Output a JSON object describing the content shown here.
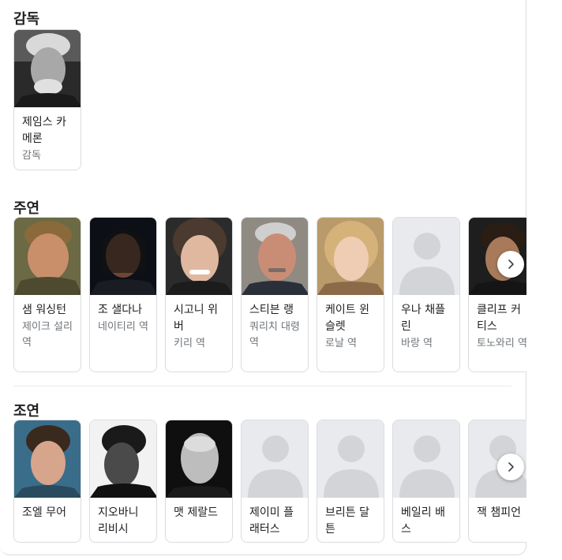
{
  "sections": {
    "director": {
      "title": "감독",
      "cards": [
        {
          "name": "제임스 카메론",
          "role": "감독"
        }
      ]
    },
    "lead": {
      "title": "주연",
      "cards": [
        {
          "name": "샘 워싱턴",
          "role": "제이크 설리 역"
        },
        {
          "name": "조 샐다나",
          "role": "네이티리 역"
        },
        {
          "name": "시고니 위버",
          "role": "키리 역"
        },
        {
          "name": "스티븐 랭",
          "role": "쿼리치 대령 역"
        },
        {
          "name": "케이트 윈슬렛",
          "role": "로날 역"
        },
        {
          "name": "우나 채플린",
          "role": "바랑 역"
        },
        {
          "name": "클리프 커티스",
          "role": "토노와리 역"
        }
      ]
    },
    "supporting": {
      "title": "조연",
      "cards": [
        {
          "name": "조엘 무어"
        },
        {
          "name": "지오바니 리비시"
        },
        {
          "name": "맷 제랄드"
        },
        {
          "name": "제이미 플래터스"
        },
        {
          "name": "브리튼 달튼"
        },
        {
          "name": "베일리 배스"
        },
        {
          "name": "잭 챔피언"
        }
      ]
    }
  },
  "icons": {
    "next": "chevron-right-icon",
    "placeholder": "person-silhouette-icon"
  },
  "colors": {
    "card_border": "#dadce0",
    "role_text": "#70757a",
    "placeholder_bg": "#e8eaed",
    "placeholder_fg": "#d2d4d8"
  }
}
